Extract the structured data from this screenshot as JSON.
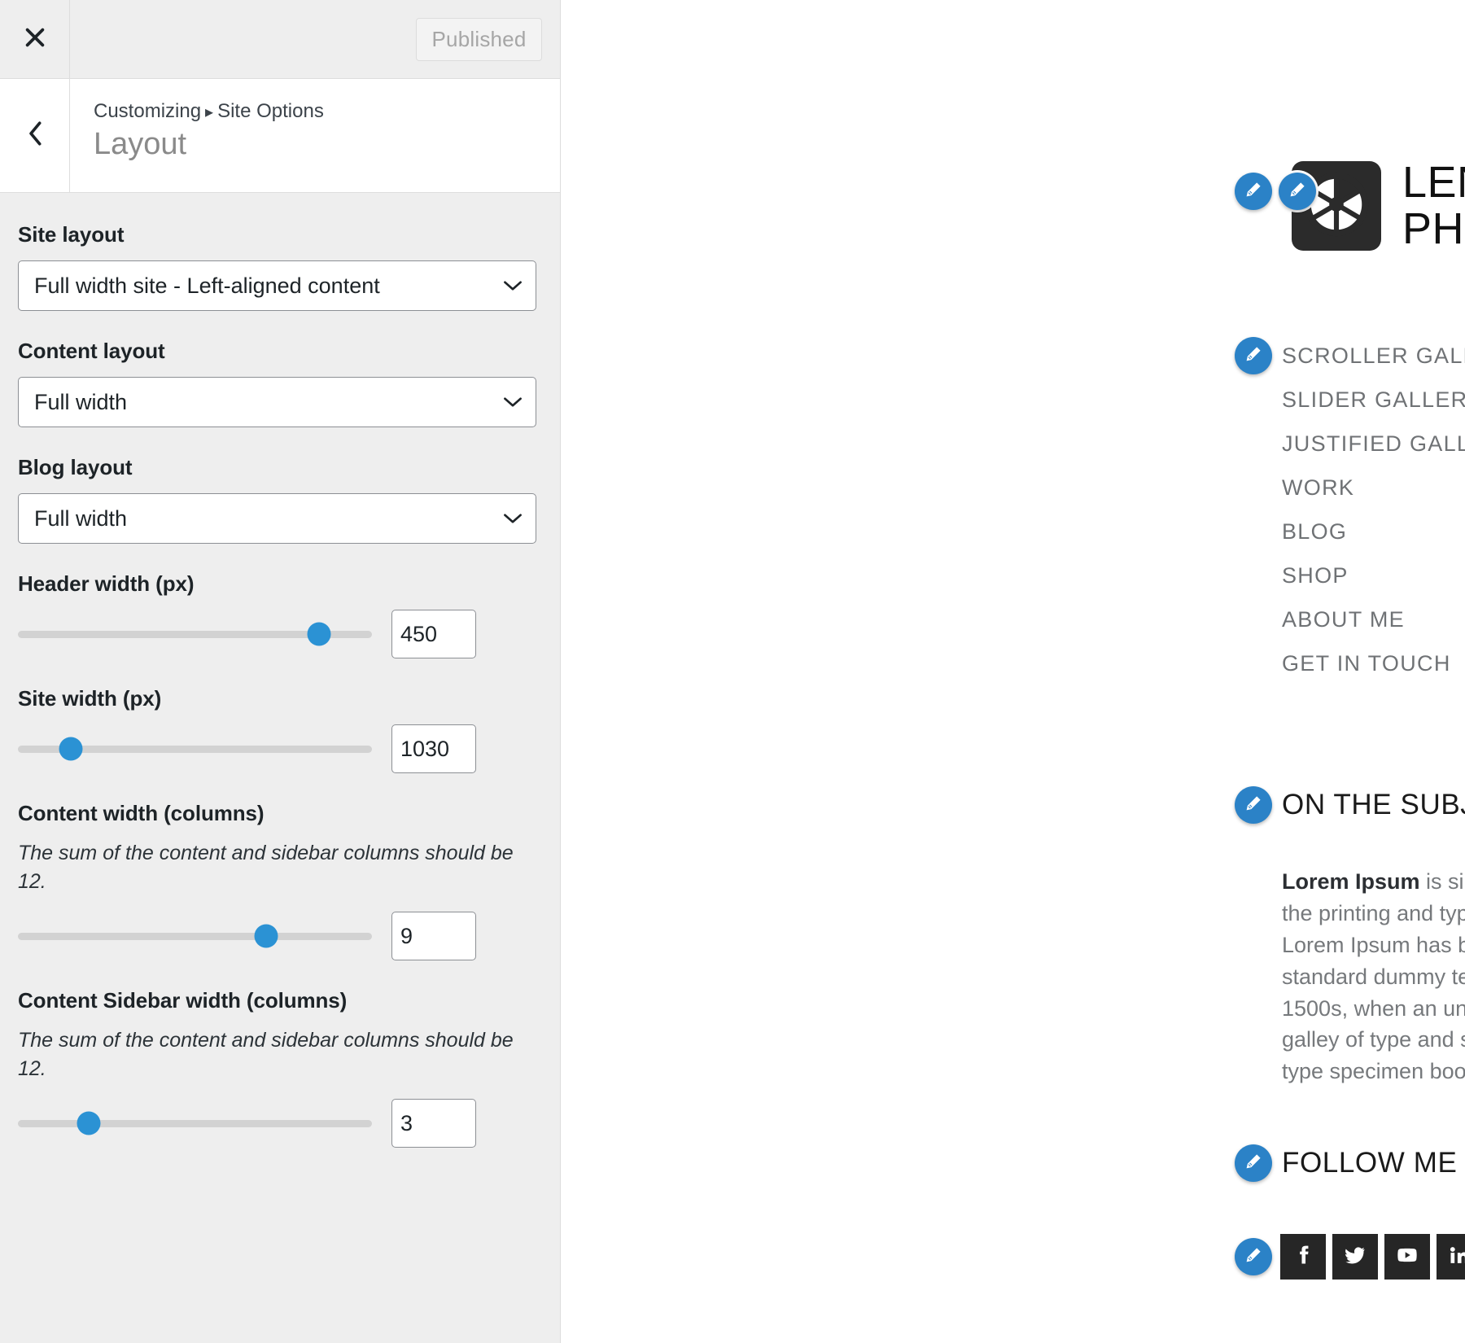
{
  "customizer": {
    "close_label": "Close customizer",
    "back_label": "Back",
    "published_label": "Published",
    "breadcrumb_root": "Customizing",
    "breadcrumb_sep": "▸",
    "breadcrumb_section": "Site Options",
    "panel_title": "Layout",
    "controls": [
      {
        "id": "site-layout",
        "label": "Site layout",
        "type": "select",
        "value": "Full width site - Left-aligned content"
      },
      {
        "id": "content-layout",
        "label": "Content layout",
        "type": "select",
        "value": "Full width"
      },
      {
        "id": "blog-layout",
        "label": "Blog layout",
        "type": "select",
        "value": "Full width"
      },
      {
        "id": "header-width",
        "label": "Header width (px)",
        "type": "slider",
        "value": "450",
        "thumb_percent": 85
      },
      {
        "id": "site-width",
        "label": "Site width (px)",
        "type": "slider",
        "value": "1030",
        "thumb_percent": 15
      },
      {
        "id": "content-width",
        "label": "Content width (columns)",
        "description": "The sum of the content and sidebar columns should be 12.",
        "type": "slider",
        "value": "9",
        "thumb_percent": 70
      },
      {
        "id": "content-sidebar-width",
        "label": "Content Sidebar width (columns)",
        "description": "The sum of the content and sidebar columns should be 12.",
        "type": "slider",
        "value": "3",
        "thumb_percent": 20
      }
    ]
  },
  "preview": {
    "logo": {
      "icon": "camera-aperture-icon",
      "line1": "LENSE",
      "line2": "PHOTOGRAPHY"
    },
    "nav": [
      {
        "label": "SCROLLER GALLERY",
        "has_edit_bubble": true,
        "has_submenu": false
      },
      {
        "label": "SLIDER GALLERY",
        "has_edit_bubble": false,
        "has_submenu": false
      },
      {
        "label": "JUSTIFIED GALLERY",
        "has_edit_bubble": false,
        "has_submenu": false
      },
      {
        "label": "WORK",
        "has_edit_bubble": false,
        "has_submenu": true
      },
      {
        "label": "BLOG",
        "has_edit_bubble": false,
        "has_submenu": false
      },
      {
        "label": "SHOP",
        "has_edit_bubble": false,
        "has_submenu": false
      },
      {
        "label": "ABOUT ME",
        "has_edit_bubble": false,
        "has_submenu": false
      },
      {
        "label": "GET IN TOUCH",
        "has_edit_bubble": false,
        "has_submenu": false
      }
    ],
    "submenu_arrow": "›",
    "about": {
      "heading": "ON THE SUBJECT OF ME",
      "lead": "Lorem Ipsum",
      "body": " is simply dummy text of the printing and typesetting industry. Lorem Ipsum has been the industry’s standard dummy text ever since the 1500s, when an unknown printer took a galley of type and scrambled it to make a type specimen book."
    },
    "follow": {
      "heading": "FOLLOW ME",
      "icons": [
        "facebook-icon",
        "twitter-icon",
        "youtube-icon",
        "linkedin-icon",
        "dribbble-icon"
      ]
    },
    "edit_bubble_icon": "pencil-edit-icon"
  },
  "colors": {
    "accent_blue": "#2b82c7",
    "slider_blue": "#2b92d4",
    "panel_bg": "#eeeeee",
    "logo_dark": "#2b2b2b",
    "social_dark": "#262626"
  }
}
